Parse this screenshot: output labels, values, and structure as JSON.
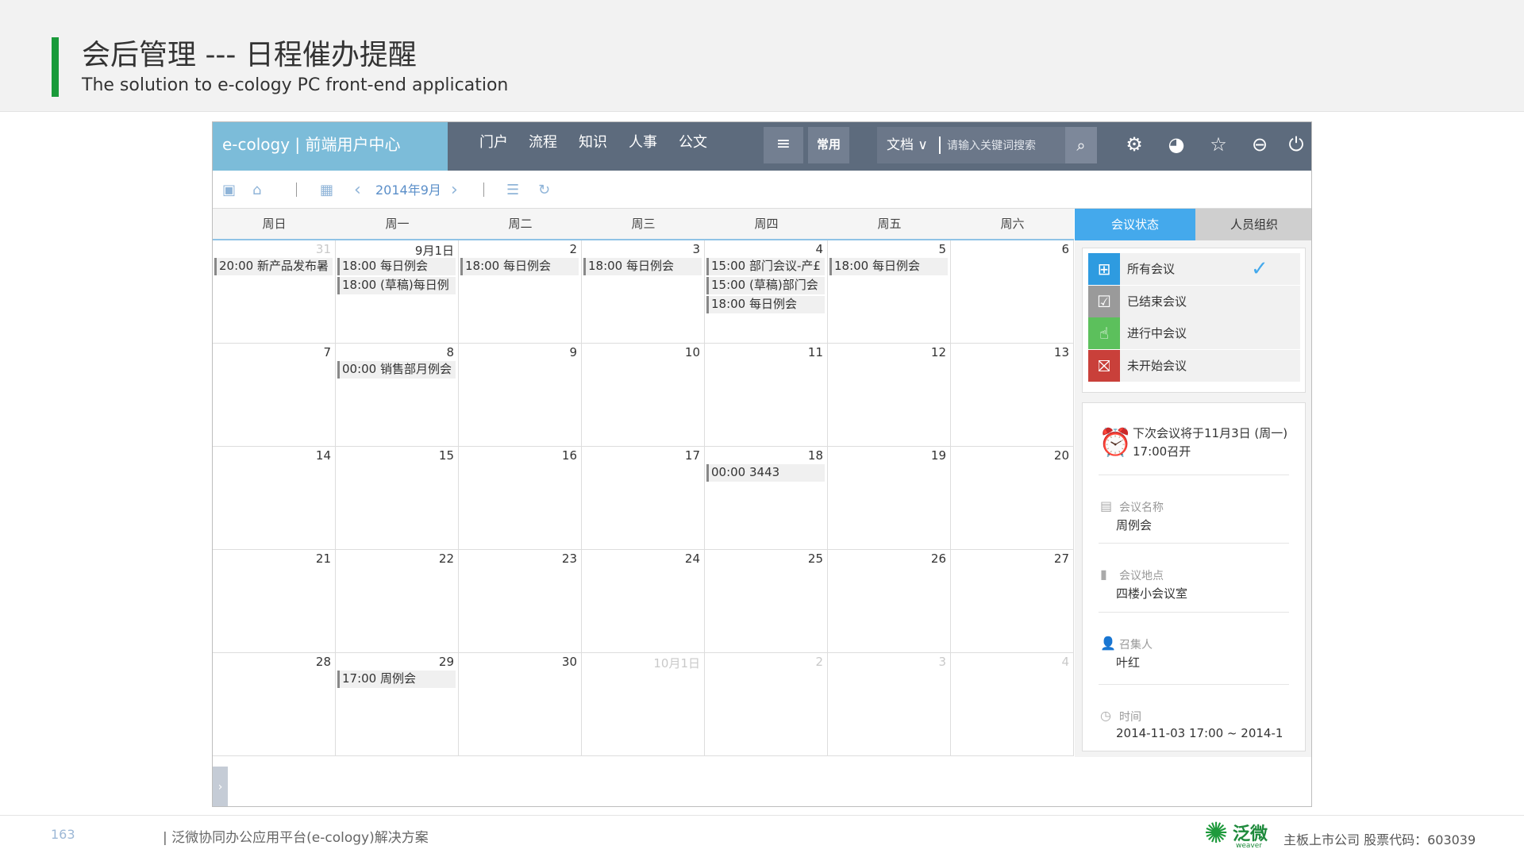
{
  "slide": {
    "title": "会后管理 --- 日程催办提醒",
    "subtitle": "The solution to e-cology PC front-end application",
    "page_number": "163",
    "footer_text": "| 泛微协同办公应用平台(e-cology)解决方案",
    "logo_text": "泛微",
    "logo_sub": "weaver",
    "company_text": "主板上市公司    股票代码：603039"
  },
  "topbar": {
    "brand": "e-cology | 前端用户中心",
    "nav": [
      "门户",
      "流程",
      "知识",
      "人事",
      "公文"
    ],
    "menu_glyph": "≡",
    "common_label": "常用",
    "doc_select": "文档 ∨",
    "search_placeholder": "请输入关键词搜索",
    "icons": {
      "search": "⌕",
      "settings": "⚙",
      "theme": "◕",
      "favorite": "☆",
      "more": "⊖",
      "power": "⏻"
    }
  },
  "toolbar": {
    "month": "2014年9月",
    "prev_glyph": "‹",
    "next_glyph": "›",
    "folder_glyph": "▣",
    "home_glyph": "⌂",
    "calendar_glyph": "▦",
    "list_glyph": "☰",
    "refresh_glyph": "↻"
  },
  "calendar": {
    "weekdays": [
      "周日",
      "周一",
      "周二",
      "周三",
      "周四",
      "周五",
      "周六"
    ],
    "weeks": [
      [
        {
          "label": "31",
          "other": true,
          "events": [
            "20:00 新产品发布暑"
          ]
        },
        {
          "label": "9月1日",
          "other": false,
          "events": [
            "18:00 每日例会",
            "18:00 (草稿)每日例"
          ]
        },
        {
          "label": "2",
          "other": false,
          "events": [
            "18:00 每日例会"
          ]
        },
        {
          "label": "3",
          "other": false,
          "events": [
            "18:00 每日例会"
          ]
        },
        {
          "label": "4",
          "other": false,
          "events": [
            "15:00 部门会议-产£",
            "15:00 (草稿)部门会",
            "18:00 每日例会"
          ]
        },
        {
          "label": "5",
          "other": false,
          "events": [
            "18:00 每日例会"
          ]
        },
        {
          "label": "6",
          "other": false,
          "events": []
        }
      ],
      [
        {
          "label": "7",
          "other": false,
          "events": []
        },
        {
          "label": "8",
          "other": false,
          "events": [
            "00:00 销售部月例会"
          ]
        },
        {
          "label": "9",
          "other": false,
          "events": []
        },
        {
          "label": "10",
          "other": false,
          "events": []
        },
        {
          "label": "11",
          "other": false,
          "events": []
        },
        {
          "label": "12",
          "other": false,
          "events": []
        },
        {
          "label": "13",
          "other": false,
          "events": []
        }
      ],
      [
        {
          "label": "14",
          "other": false,
          "events": []
        },
        {
          "label": "15",
          "other": false,
          "events": []
        },
        {
          "label": "16",
          "other": false,
          "events": []
        },
        {
          "label": "17",
          "other": false,
          "events": []
        },
        {
          "label": "18",
          "other": false,
          "events": [
            "00:00 3443"
          ]
        },
        {
          "label": "19",
          "other": false,
          "events": []
        },
        {
          "label": "20",
          "other": false,
          "events": []
        }
      ],
      [
        {
          "label": "21",
          "other": false,
          "events": []
        },
        {
          "label": "22",
          "other": false,
          "events": []
        },
        {
          "label": "23",
          "other": false,
          "events": []
        },
        {
          "label": "24",
          "other": false,
          "events": []
        },
        {
          "label": "25",
          "other": false,
          "events": []
        },
        {
          "label": "26",
          "other": false,
          "events": []
        },
        {
          "label": "27",
          "other": false,
          "events": []
        }
      ],
      [
        {
          "label": "28",
          "other": false,
          "events": []
        },
        {
          "label": "29",
          "other": false,
          "events": [
            "17:00 周例会"
          ]
        },
        {
          "label": "30",
          "other": false,
          "events": []
        },
        {
          "label": "10月1日",
          "other": true,
          "events": []
        },
        {
          "label": "2",
          "other": true,
          "events": []
        },
        {
          "label": "3",
          "other": true,
          "events": []
        },
        {
          "label": "4",
          "other": true,
          "events": []
        }
      ]
    ]
  },
  "side": {
    "tabs": {
      "status": "会议状态",
      "people": "人员组织"
    },
    "status_items": [
      {
        "label": "所有会议",
        "color": "#2e9be0",
        "icon": "grid-icon",
        "glyph": "⊞"
      },
      {
        "label": "已结束会议",
        "color": "#9a9a9a",
        "icon": "check-box-icon",
        "glyph": "☑"
      },
      {
        "label": "进行中会议",
        "color": "#5cc05c",
        "icon": "hand-icon",
        "glyph": "☝"
      },
      {
        "label": "未开始会议",
        "color": "#c9403a",
        "icon": "no-start-icon",
        "glyph": "⛝"
      }
    ],
    "check_glyph": "✓",
    "next_meeting": "下次会议将于11月3日 (周一) 17:00召开",
    "clock_glyph": "⏰",
    "fields": [
      {
        "label": "会议名称",
        "value": "周例会",
        "icon": "clipboard-icon",
        "glyph": "▤"
      },
      {
        "label": "会议地点",
        "value": "四楼小会议室",
        "icon": "bookmark-icon",
        "glyph": "▮"
      },
      {
        "label": "召集人",
        "value": "叶红",
        "icon": "person-icon",
        "glyph": "👤"
      },
      {
        "label": "时间",
        "value": "2014-11-03 17:00 ~ 2014-1",
        "icon": "time-icon",
        "glyph": "◷"
      }
    ]
  },
  "expand_glyph": "›",
  "colors": {
    "accent": "#1a9a3a",
    "brand": "#7cbcd9",
    "topbar": "#5d6b7d",
    "active_tab": "#44a9ec"
  }
}
